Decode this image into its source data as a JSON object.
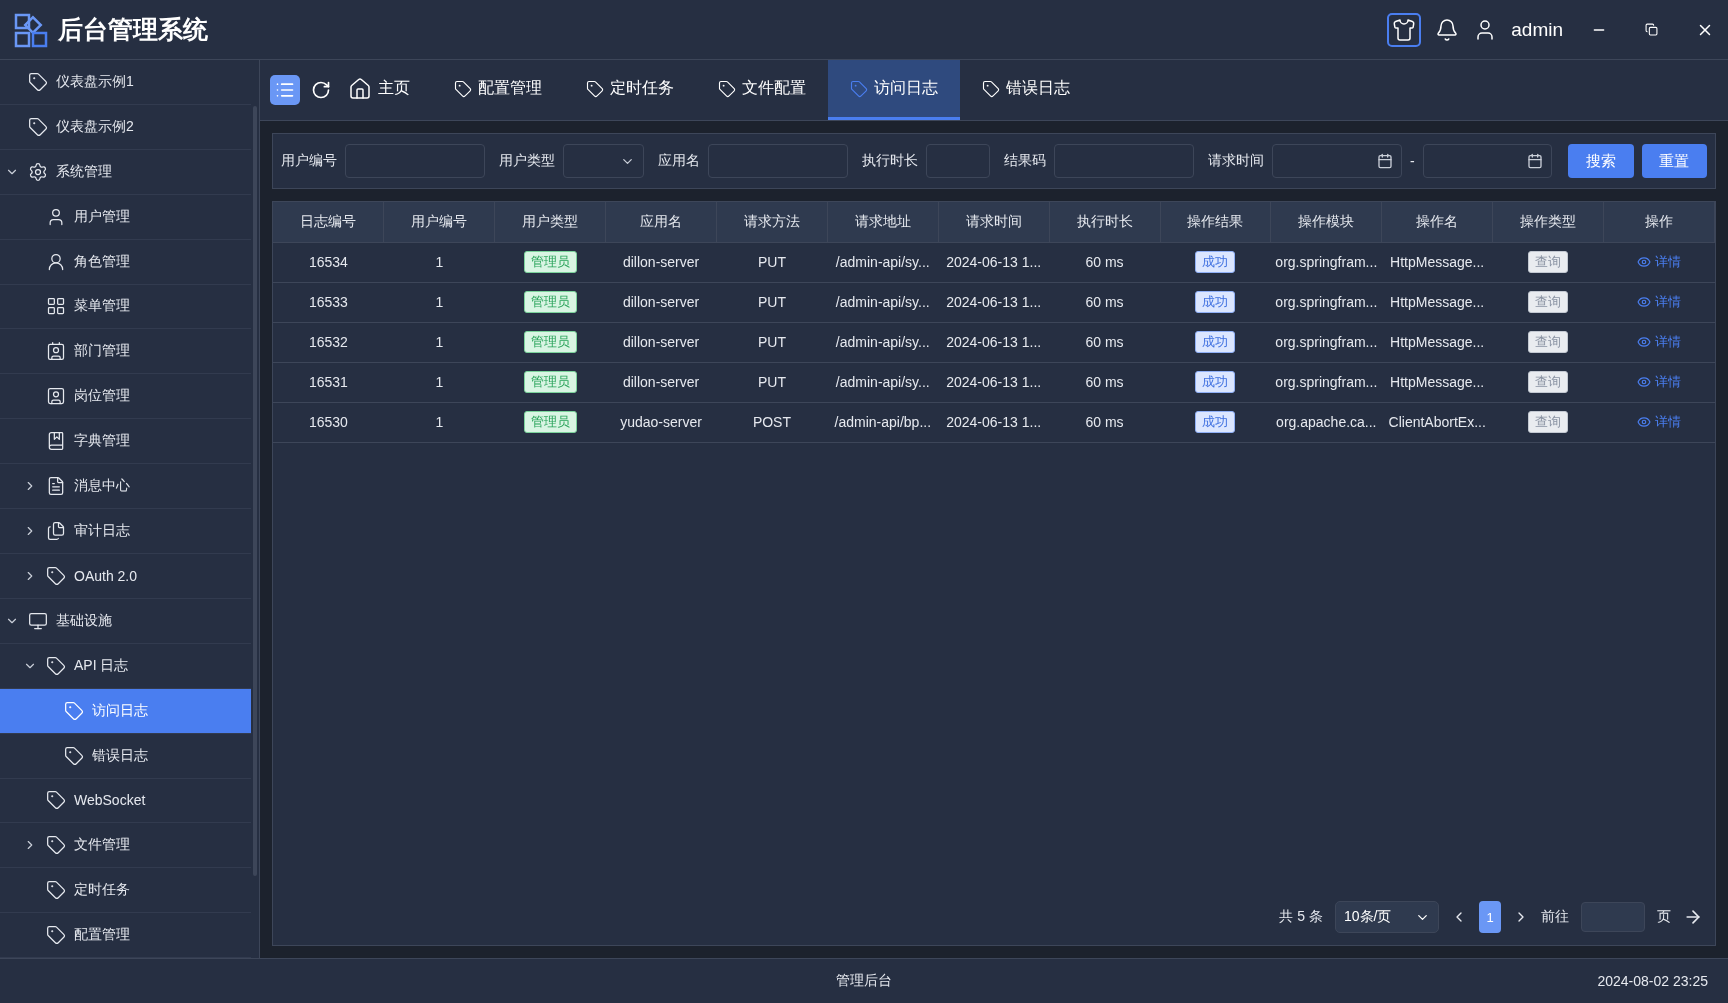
{
  "app": {
    "title": "后台管理系统",
    "user": "admin"
  },
  "sidebar": {
    "items": [
      {
        "label": "仪表盘示例1",
        "selected": false
      },
      {
        "label": "仪表盘示例2",
        "selected": false
      },
      {
        "label": "系统管理",
        "selected": false,
        "expanded": true,
        "children": [
          {
            "label": "用户管理",
            "selected": false
          },
          {
            "label": "角色管理",
            "selected": false
          },
          {
            "label": "菜单管理",
            "selected": false
          },
          {
            "label": "部门管理",
            "selected": false
          },
          {
            "label": "岗位管理",
            "selected": false
          },
          {
            "label": "字典管理",
            "selected": false
          },
          {
            "label": "消息中心",
            "selected": false,
            "expanded": false
          },
          {
            "label": "审计日志",
            "selected": false,
            "expanded": false
          },
          {
            "label": "OAuth 2.0",
            "selected": false,
            "expanded": false
          }
        ]
      },
      {
        "label": "基础设施",
        "selected": false,
        "expanded": true,
        "children": [
          {
            "label": "API 日志",
            "selected": false,
            "expanded": true,
            "children": [
              {
                "label": "访问日志",
                "selected": true
              },
              {
                "label": "错误日志",
                "selected": false
              }
            ]
          },
          {
            "label": "WebSocket",
            "selected": false
          },
          {
            "label": "文件管理",
            "selected": false,
            "expanded": false
          },
          {
            "label": "定时任务",
            "selected": false
          },
          {
            "label": "配置管理",
            "selected": false
          }
        ]
      }
    ]
  },
  "tabs": [
    {
      "label": "主页",
      "selected": false,
      "kind": "home"
    },
    {
      "label": "配置管理",
      "selected": false,
      "kind": "tag"
    },
    {
      "label": "定时任务",
      "selected": false,
      "kind": "tag"
    },
    {
      "label": "文件配置",
      "selected": false,
      "kind": "tag"
    },
    {
      "label": "访问日志",
      "selected": true,
      "kind": "tag"
    },
    {
      "label": "错误日志",
      "selected": false,
      "kind": "tag"
    }
  ],
  "filters": [
    {
      "label": "用户编号",
      "kind": "text"
    },
    {
      "label": "用户类型",
      "kind": "select"
    },
    {
      "label": "应用名",
      "kind": "text"
    },
    {
      "label": "执行时长",
      "kind": "text"
    },
    {
      "label": "结果码",
      "kind": "text"
    },
    {
      "label": "请求时间",
      "kind": "daterange",
      "separator": "-"
    }
  ],
  "filter_buttons": [
    {
      "label": "搜索"
    },
    {
      "label": "重置"
    }
  ],
  "table": {
    "columns": [
      "日志编号",
      "用户编号",
      "用户类型",
      "应用名",
      "请求方法",
      "请求地址",
      "请求时间",
      "执行时长",
      "操作结果",
      "操作模块",
      "操作名",
      "操作类型",
      "操作"
    ],
    "rows": [
      {
        "id": "16534",
        "user_id": "1",
        "user_type": "管理员",
        "app": "dillon-server",
        "method": "PUT",
        "url": "/admin-api/sy...",
        "time": "2024-06-13 1...",
        "duration": "60 ms",
        "result": "成功",
        "module": "org.springfram...",
        "operation": "HttpMessage...",
        "op_type": "查询",
        "action": "详情"
      },
      {
        "id": "16533",
        "user_id": "1",
        "user_type": "管理员",
        "app": "dillon-server",
        "method": "PUT",
        "url": "/admin-api/sy...",
        "time": "2024-06-13 1...",
        "duration": "60 ms",
        "result": "成功",
        "module": "org.springfram...",
        "operation": "HttpMessage...",
        "op_type": "查询",
        "action": "详情"
      },
      {
        "id": "16532",
        "user_id": "1",
        "user_type": "管理员",
        "app": "dillon-server",
        "method": "PUT",
        "url": "/admin-api/sy...",
        "time": "2024-06-13 1...",
        "duration": "60 ms",
        "result": "成功",
        "module": "org.springfram...",
        "operation": "HttpMessage...",
        "op_type": "查询",
        "action": "详情"
      },
      {
        "id": "16531",
        "user_id": "1",
        "user_type": "管理员",
        "app": "dillon-server",
        "method": "PUT",
        "url": "/admin-api/sy...",
        "time": "2024-06-13 1...",
        "duration": "60 ms",
        "result": "成功",
        "module": "org.springfram...",
        "operation": "HttpMessage...",
        "op_type": "查询",
        "action": "详情"
      },
      {
        "id": "16530",
        "user_id": "1",
        "user_type": "管理员",
        "app": "yudao-server",
        "method": "POST",
        "url": "/admin-api/bp...",
        "time": "2024-06-13 1...",
        "duration": "60 ms",
        "result": "成功",
        "module": "org.apache.ca...",
        "operation": "ClientAbortEx...",
        "op_type": "查询",
        "action": "详情"
      }
    ]
  },
  "pagination": {
    "total": "共 5 条",
    "page_size": "10条/页",
    "pages": [
      {
        "label": "1",
        "selected": true
      }
    ],
    "goto": "前往",
    "page_unit": "页"
  },
  "footer": {
    "center": "管理后台",
    "time": "2024-08-02 23:25"
  }
}
